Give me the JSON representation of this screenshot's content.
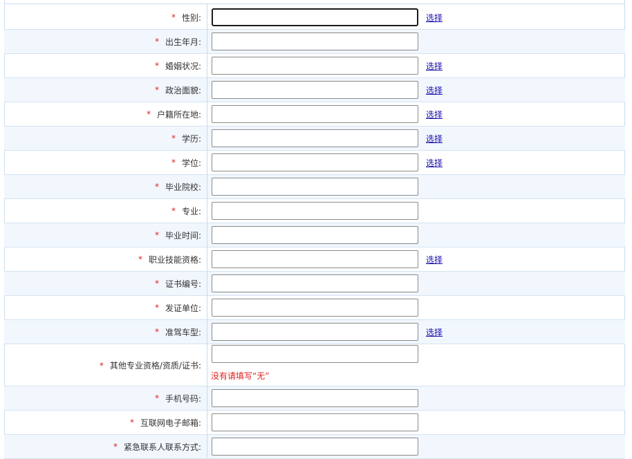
{
  "colors": {
    "required": "#e22020",
    "link": "#1a0dab",
    "row_alt": "#f1f7fd",
    "grid": "#c6dcef"
  },
  "form": {
    "required_mark": "*",
    "choose_label": "选择",
    "fields": [
      {
        "label": "性别:",
        "value": "",
        "choose": true,
        "focused": true
      },
      {
        "label": "出生年月:",
        "value": "",
        "choose": false
      },
      {
        "label": "婚姻状况:",
        "value": "",
        "choose": true
      },
      {
        "label": "政治面貌:",
        "value": "",
        "choose": true
      },
      {
        "label": "户籍所在地:",
        "value": "",
        "choose": true
      },
      {
        "label": "学历:",
        "value": "",
        "choose": true
      },
      {
        "label": "学位:",
        "value": "",
        "choose": true
      },
      {
        "label": "毕业院校:",
        "value": "",
        "choose": false
      },
      {
        "label": "专业:",
        "value": "",
        "choose": false
      },
      {
        "label": "毕业时间:",
        "value": "",
        "choose": false
      },
      {
        "label": "职业技能资格:",
        "value": "",
        "choose": true
      },
      {
        "label": "证书编号:",
        "value": "",
        "choose": false
      },
      {
        "label": "发证单位:",
        "value": "",
        "choose": false
      },
      {
        "label": "准驾车型:",
        "value": "",
        "choose": true
      },
      {
        "label": "其他专业资格/资质/证书:",
        "value": "",
        "choose": false,
        "hint": "没有请填写“无”"
      },
      {
        "label": "手机号码:",
        "value": "",
        "choose": false
      },
      {
        "label": "互联网电子邮箱:",
        "value": "",
        "choose": false
      },
      {
        "label": "紧急联系人联系方式:",
        "value": "",
        "choose": false
      }
    ]
  }
}
